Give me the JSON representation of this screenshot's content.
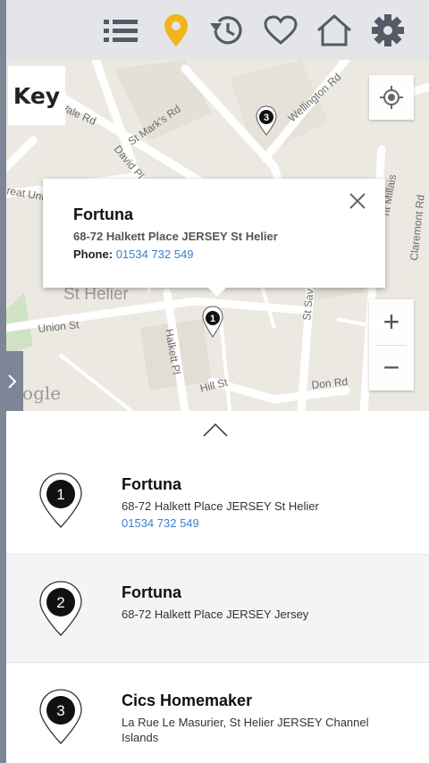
{
  "toolbar": {
    "icons": [
      "list-icon",
      "location-pin-icon",
      "history-icon",
      "heart-icon",
      "home-icon",
      "gear-icon"
    ],
    "active_color": "#f1b51c",
    "icon_color": "#555a66"
  },
  "map": {
    "key_label": "Key",
    "street_labels": {
      "st_marks": "St Mark's Rd",
      "wellington": "Wellington Rd",
      "david_pl": "David Pl",
      "vale_rd": "Vale Rd",
      "great_union": "reat Uni",
      "union_st": "Union St",
      "st_helier": "St Helier",
      "halkett_pl": "Halkett Pl",
      "hill_st": "Hill St",
      "don_rd": "Don Rd",
      "st_sav": "St Sav",
      "millais": "nt Millais",
      "claremont": "Claremont Rd"
    },
    "markers": [
      "3",
      "1"
    ],
    "attribution": "oogle",
    "zoom_in": "+",
    "zoom_out": "−"
  },
  "popup": {
    "title": "Fortuna",
    "address": "68-72 Halkett Place JERSEY St Helier",
    "phone_label": "Phone:",
    "phone": "01534 732 549"
  },
  "results": [
    {
      "number": "1",
      "name": "Fortuna",
      "address": "68-72 Halkett Place JERSEY St Helier",
      "phone": "01534 732 549"
    },
    {
      "number": "2",
      "name": "Fortuna",
      "address": "68-72 Halkett Place JERSEY Jersey",
      "phone": ""
    },
    {
      "number": "3",
      "name": "Cics Homemaker",
      "address": "La Rue Le Masurier, St Helier JERSEY Channel Islands",
      "phone": ""
    }
  ],
  "colors": {
    "link": "#3a7fcf",
    "sidebar": "#7d8596",
    "topbar": "#e3e5e9"
  }
}
